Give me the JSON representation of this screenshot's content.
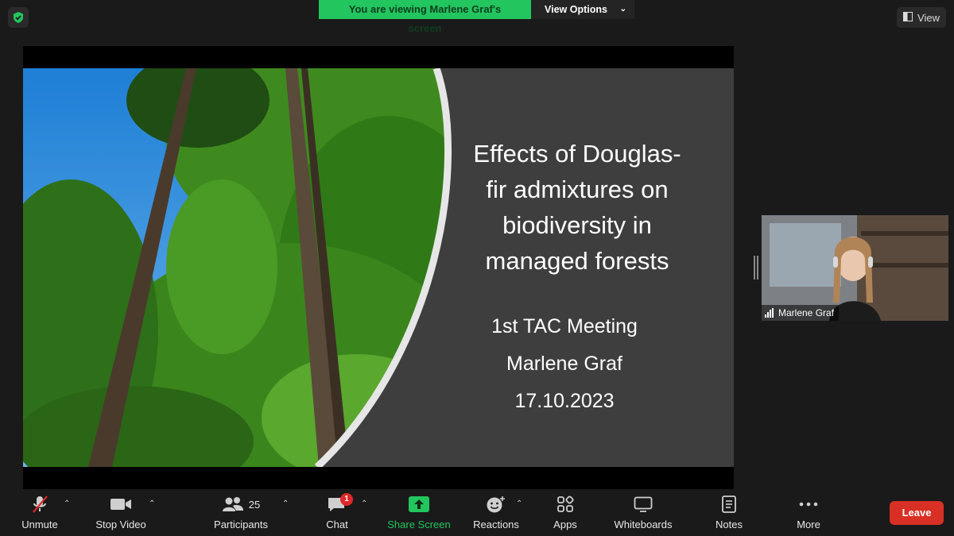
{
  "top_bar": {
    "viewing_text": "You are viewing Marlene Graf's screen",
    "view_options_label": "View Options",
    "view_label": "View"
  },
  "slide": {
    "title_lines": [
      "Effects of Douglas-",
      "fir admixtures on",
      "biodiversity in",
      "managed forests"
    ],
    "meeting": "1st TAC Meeting",
    "presenter": "Marlene Graf",
    "date": "17.10.2023"
  },
  "video": {
    "participant_name": "Marlene Graf"
  },
  "toolbar": {
    "unmute": "Unmute",
    "stop_video": "Stop Video",
    "participants": "Participants",
    "participants_count": "25",
    "chat": "Chat",
    "chat_badge": "1",
    "share_screen": "Share Screen",
    "reactions": "Reactions",
    "apps": "Apps",
    "whiteboards": "Whiteboards",
    "notes": "Notes",
    "more": "More",
    "leave": "Leave"
  },
  "colors": {
    "accent_green": "#22c55e",
    "leave_red": "#d93025",
    "toolbar_bg": "#1a1a1a",
    "slide_bg": "#3e3e3e"
  }
}
